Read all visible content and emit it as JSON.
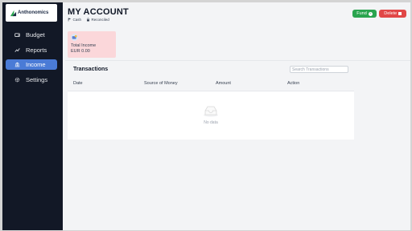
{
  "sidebar": {
    "logo_text": "Anthonomics",
    "items": [
      {
        "label": "Budget",
        "icon": "wallet-icon",
        "active": false
      },
      {
        "label": "Reports",
        "icon": "chart-line-icon",
        "active": false
      },
      {
        "label": "Income",
        "icon": "bank-icon",
        "active": true
      },
      {
        "label": "Settings",
        "icon": "gear-icon",
        "active": false
      }
    ]
  },
  "header": {
    "title": "MY ACCOUNT",
    "tags": [
      {
        "label": "Cash",
        "icon": "flag-icon"
      },
      {
        "label": "Reconciled",
        "icon": "lock-icon"
      }
    ],
    "fund_label": "Fund",
    "delete_label": "Delete"
  },
  "summary_card": {
    "label": "Total Income",
    "value": "EUR 0.00",
    "icon": "wallet-coin-icon",
    "color": "#fbd7da"
  },
  "transactions": {
    "title": "Transactions",
    "search_placeholder": "Search Transactions",
    "columns": [
      "Date",
      "Source of Money",
      "Amount",
      "Action"
    ],
    "empty_text": "No data"
  },
  "colors": {
    "sidebar_bg": "#121826",
    "active_nav": "#4a7bd6",
    "fund": "#2aa44f",
    "delete": "#e14747"
  }
}
